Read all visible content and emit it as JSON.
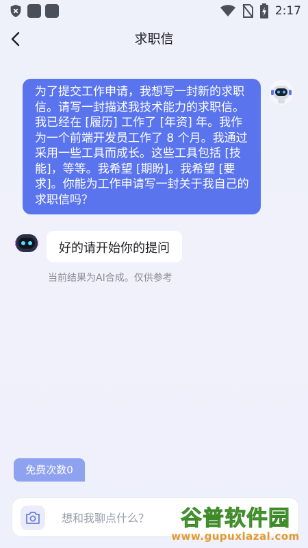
{
  "status_bar": {
    "time": "2:17",
    "icons": [
      "shield-icon",
      "app-icon",
      "app-icon",
      "wifi-icon",
      "no-sim-icon",
      "battery-charging-icon"
    ]
  },
  "nav": {
    "title": "求职信",
    "back_icon": "back-arrow-icon"
  },
  "chat": {
    "user_message": "为了提交工作申请，我想写一封新的求职信。请写一封描述我技术能力的求职信。我已经在 [履历] 工作了 [年资] 年。我作为一个前端开发员工作了 8 个月。我通过采用一些工具而成长。这些工具包括 [技能]，等等。我希望 [期盼]。我希望 [要求]。你能为工作申请写一封关于我自己的求职信吗？",
    "bot_message": "好的请开始你的提问",
    "disclaimer": "当前结果为AI合成。仅供参考"
  },
  "footer": {
    "free_count_label": "免费次数0",
    "input_placeholder": "想和我聊点什么？",
    "camera_icon": "camera-icon"
  },
  "watermark": {
    "mark": "谷普软件园",
    "url": "www.gupuxlazal.com"
  },
  "colors": {
    "accent": "#5a74ee",
    "free_badge": "#8ea2ef",
    "background": "#eef1fa"
  }
}
